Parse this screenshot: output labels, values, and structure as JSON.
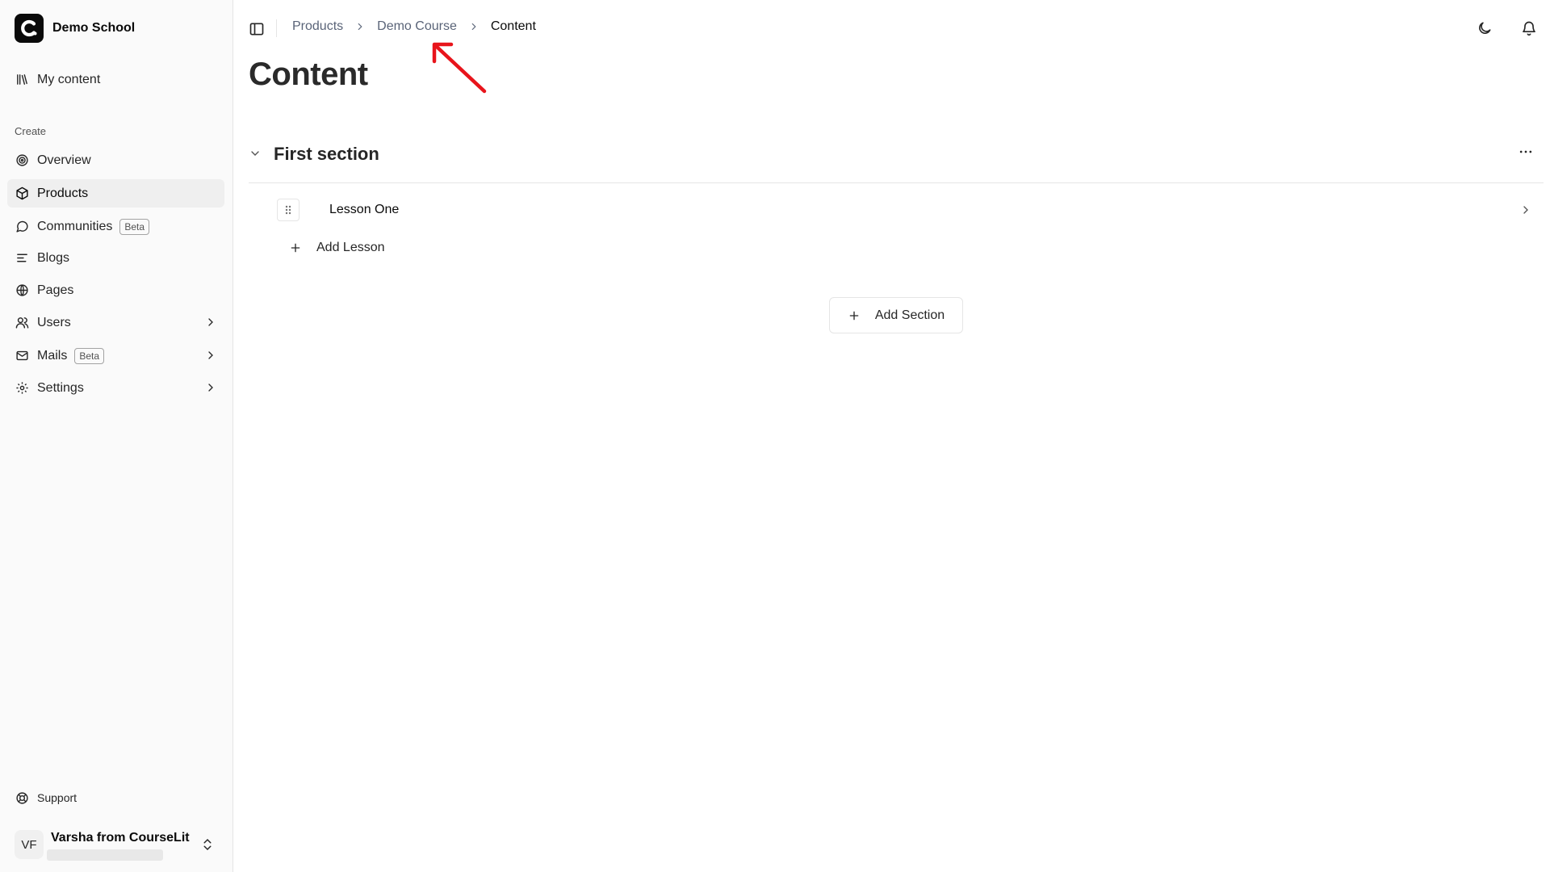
{
  "brand": {
    "name": "Demo School",
    "logo_letter": "C"
  },
  "sidebar": {
    "top_items": [
      {
        "label": "My content",
        "icon": "library-icon"
      }
    ],
    "group_label": "Create",
    "items": [
      {
        "label": "Overview",
        "icon": "target-icon",
        "active": false
      },
      {
        "label": "Products",
        "icon": "box-icon",
        "active": true
      },
      {
        "label": "Communities",
        "icon": "message-circle-icon",
        "badge": "Beta",
        "active": false
      },
      {
        "label": "Blogs",
        "icon": "text-lines-icon",
        "active": false
      },
      {
        "label": "Pages",
        "icon": "globe-icon",
        "active": false
      },
      {
        "label": "Users",
        "icon": "users-icon",
        "has_submenu": true,
        "active": false
      },
      {
        "label": "Mails",
        "icon": "mail-icon",
        "badge": "Beta",
        "has_submenu": true,
        "active": false
      },
      {
        "label": "Settings",
        "icon": "gear-icon",
        "has_submenu": true,
        "active": false
      }
    ],
    "support_label": "Support",
    "user": {
      "initials": "VF",
      "name": "Varsha from CourseLit"
    }
  },
  "breadcrumb": {
    "items": [
      "Products",
      "Demo Course"
    ],
    "current": "Content"
  },
  "page": {
    "title": "Content"
  },
  "sections": [
    {
      "title": "First section",
      "lessons": [
        {
          "title": "Lesson One"
        }
      ],
      "add_lesson_label": "Add Lesson"
    }
  ],
  "add_section_label": "Add Section",
  "colors": {
    "annotation_arrow": "#e8141b",
    "accent": "#0a0a0a"
  }
}
